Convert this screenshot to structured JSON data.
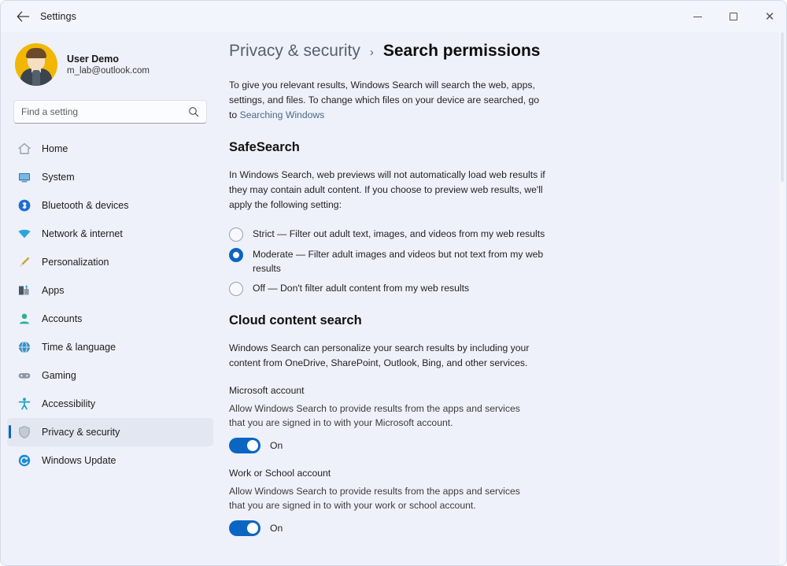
{
  "window": {
    "title": "Settings",
    "back_icon": "back-arrow-icon",
    "controls": {
      "minimize": "minimize-icon",
      "maximize": "maximize-icon",
      "close": "close-icon"
    }
  },
  "sidebar": {
    "profile": {
      "name": "User Demo",
      "email": "m_lab@outlook.com",
      "avatar_color": "#f2b705"
    },
    "search": {
      "placeholder": "Find a setting",
      "value": "",
      "icon": "search-icon"
    },
    "items": [
      {
        "label": "Home",
        "icon": "home-icon",
        "color": "#9aa3ad",
        "selected": false
      },
      {
        "label": "System",
        "icon": "display-icon",
        "color": "#2b7bb9",
        "selected": false
      },
      {
        "label": "Bluetooth & devices",
        "icon": "bluetooth-icon",
        "color": "#1f6fd0",
        "selected": false
      },
      {
        "label": "Network & internet",
        "icon": "wifi-icon",
        "color": "#2aa5e0",
        "selected": false
      },
      {
        "label": "Personalization",
        "icon": "brush-icon",
        "color": "#c9a227",
        "selected": false
      },
      {
        "label": "Apps",
        "icon": "apps-icon",
        "color": "#4a5560",
        "selected": false
      },
      {
        "label": "Accounts",
        "icon": "person-icon",
        "color": "#2fae9b",
        "selected": false
      },
      {
        "label": "Time & language",
        "icon": "globe-clock-icon",
        "color": "#3b8fc4",
        "selected": false
      },
      {
        "label": "Gaming",
        "icon": "gamepad-icon",
        "color": "#8d99a6",
        "selected": false
      },
      {
        "label": "Accessibility",
        "icon": "accessibility-icon",
        "color": "#17a2c4",
        "selected": false
      },
      {
        "label": "Privacy & security",
        "icon": "shield-icon",
        "color": "#9aa3ad",
        "selected": true
      },
      {
        "label": "Windows Update",
        "icon": "update-icon",
        "color": "#1f8ad6",
        "selected": false
      }
    ],
    "accent_color": "#0b65c2",
    "selected_bg": "#e3e7f2"
  },
  "breadcrumb": {
    "parent": "Privacy & security",
    "separator": "›",
    "current": "Search permissions"
  },
  "intro": {
    "text_before": "To give you relevant results, Windows Search will search the web, apps, settings, and files. To change which files on your device are searched, go to ",
    "link": "Searching Windows"
  },
  "safesearch": {
    "heading": "SafeSearch",
    "description": "In Windows Search, web previews will not automatically load web results if they may contain adult content. If you choose to preview web results, we'll apply the following setting:",
    "options": [
      {
        "label": "Strict — Filter out adult text, images, and videos from my web results",
        "checked": false
      },
      {
        "label": "Moderate — Filter adult images and videos but not text from my web results",
        "checked": true
      },
      {
        "label": "Off — Don't filter adult content from my web results",
        "checked": false
      }
    ]
  },
  "cloud_content_search": {
    "heading": "Cloud content search",
    "description": "Windows Search can personalize your search results by including your content from OneDrive, SharePoint, Outlook, Bing, and other services.",
    "settings": [
      {
        "title": "Microsoft account",
        "description": "Allow Windows Search to provide results from the apps and services that you are signed in to with your Microsoft account.",
        "state": "On",
        "enabled": true
      },
      {
        "title": "Work or School account",
        "description": "Allow Windows Search to provide results from the apps and services that you are signed in to with your work or school account.",
        "state": "On",
        "enabled": true
      }
    ]
  }
}
